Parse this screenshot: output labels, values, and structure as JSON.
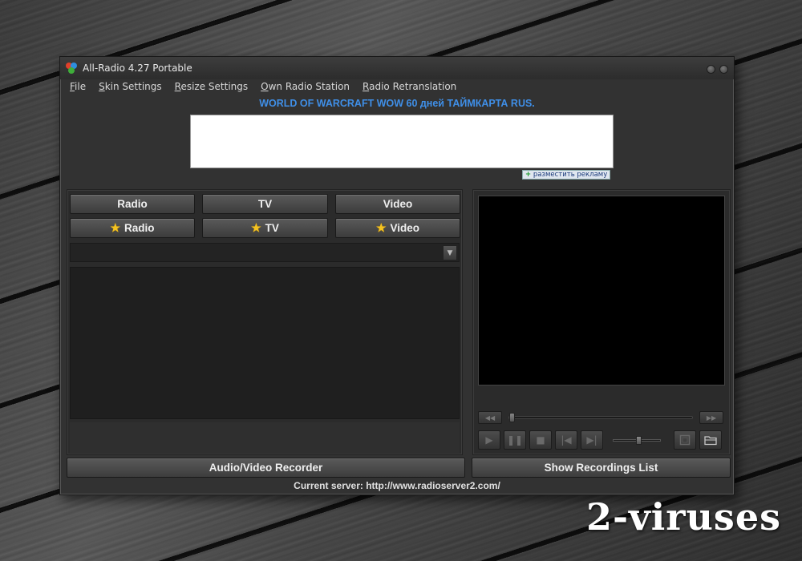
{
  "window": {
    "title": "All-Radio 4.27 Portable"
  },
  "menu": [
    {
      "first": "F",
      "rest": "ile"
    },
    {
      "first": "S",
      "rest": "kin Settings"
    },
    {
      "first": "R",
      "rest": "esize Settings"
    },
    {
      "first": "O",
      "rest": "wn Radio Station"
    },
    {
      "first": "R",
      "rest": "adio Retranslation"
    }
  ],
  "banner": {
    "title": "WORLD OF WARCRAFT WOW 60 дней ТАЙМКАРТА RUS.",
    "ad_link_plus": "+",
    "ad_link": "разместить рекламу"
  },
  "tabs": {
    "radio": "Radio",
    "tv": "TV",
    "video": "Video",
    "fav_radio": "Radio",
    "fav_tv": "TV",
    "fav_video": "Video",
    "star": "★"
  },
  "dropdown": {
    "value": "",
    "arrow": "▼"
  },
  "player": {
    "rewind": "◀◀",
    "forward": "▶▶",
    "play": "▶",
    "pause": "❚❚",
    "stop": "■",
    "prev": "|◀",
    "next": "▶|",
    "seek_position": 0.0,
    "volume": 0.55
  },
  "buttons": {
    "recorder": "Audio/Video Recorder",
    "recordings": "Show Recordings List"
  },
  "status": {
    "server": "Current server: http://www.radioserver2.com/"
  },
  "watermark": "2-viruses",
  "colors": {
    "accent_blue": "#3f8fe8",
    "star_yellow": "#f4c320"
  }
}
